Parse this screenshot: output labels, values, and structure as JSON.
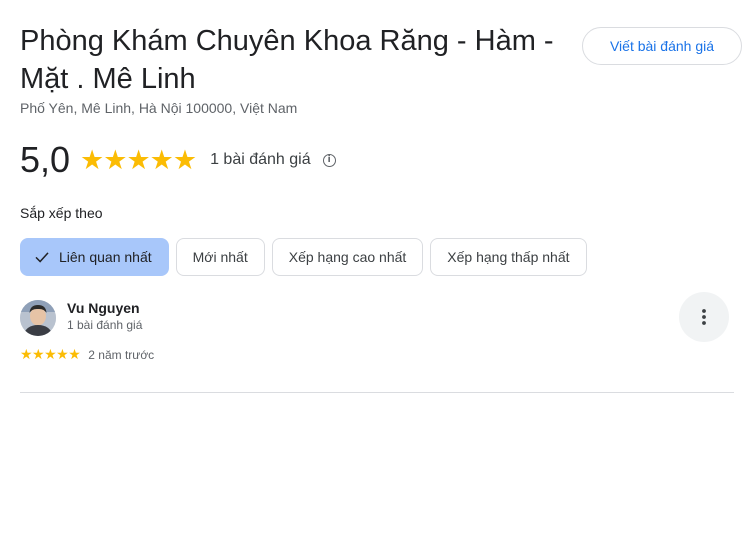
{
  "place": {
    "name": "Phòng Khám Chuyên Khoa Răng - Hàm - Mặt . Mê Linh",
    "address": "Phố Yên, Mê Linh, Hà Nội 100000, Việt Nam"
  },
  "write_review_label": "Viết bài đánh giá",
  "summary": {
    "rating": "5,0",
    "stars": "★★★★★",
    "star_count": 5,
    "review_count": "1 bài đánh giá",
    "info_icon": "info-icon"
  },
  "sort": {
    "label": "Sắp xếp theo",
    "options": [
      {
        "label": "Liên quan nhất",
        "selected": true
      },
      {
        "label": "Mới nhất",
        "selected": false
      },
      {
        "label": "Xếp hạng cao nhất",
        "selected": false
      },
      {
        "label": "Xếp hạng thấp nhất",
        "selected": false
      }
    ]
  },
  "reviews": [
    {
      "author": "Vu Nguyen",
      "author_meta": "1 bài đánh giá",
      "stars": "★★★★★",
      "rating": 5,
      "time": "2 năm trước"
    }
  ],
  "colors": {
    "star": "#fbbc04",
    "accent": "#1a73e8",
    "chip_selected": "#a8c7fa"
  }
}
